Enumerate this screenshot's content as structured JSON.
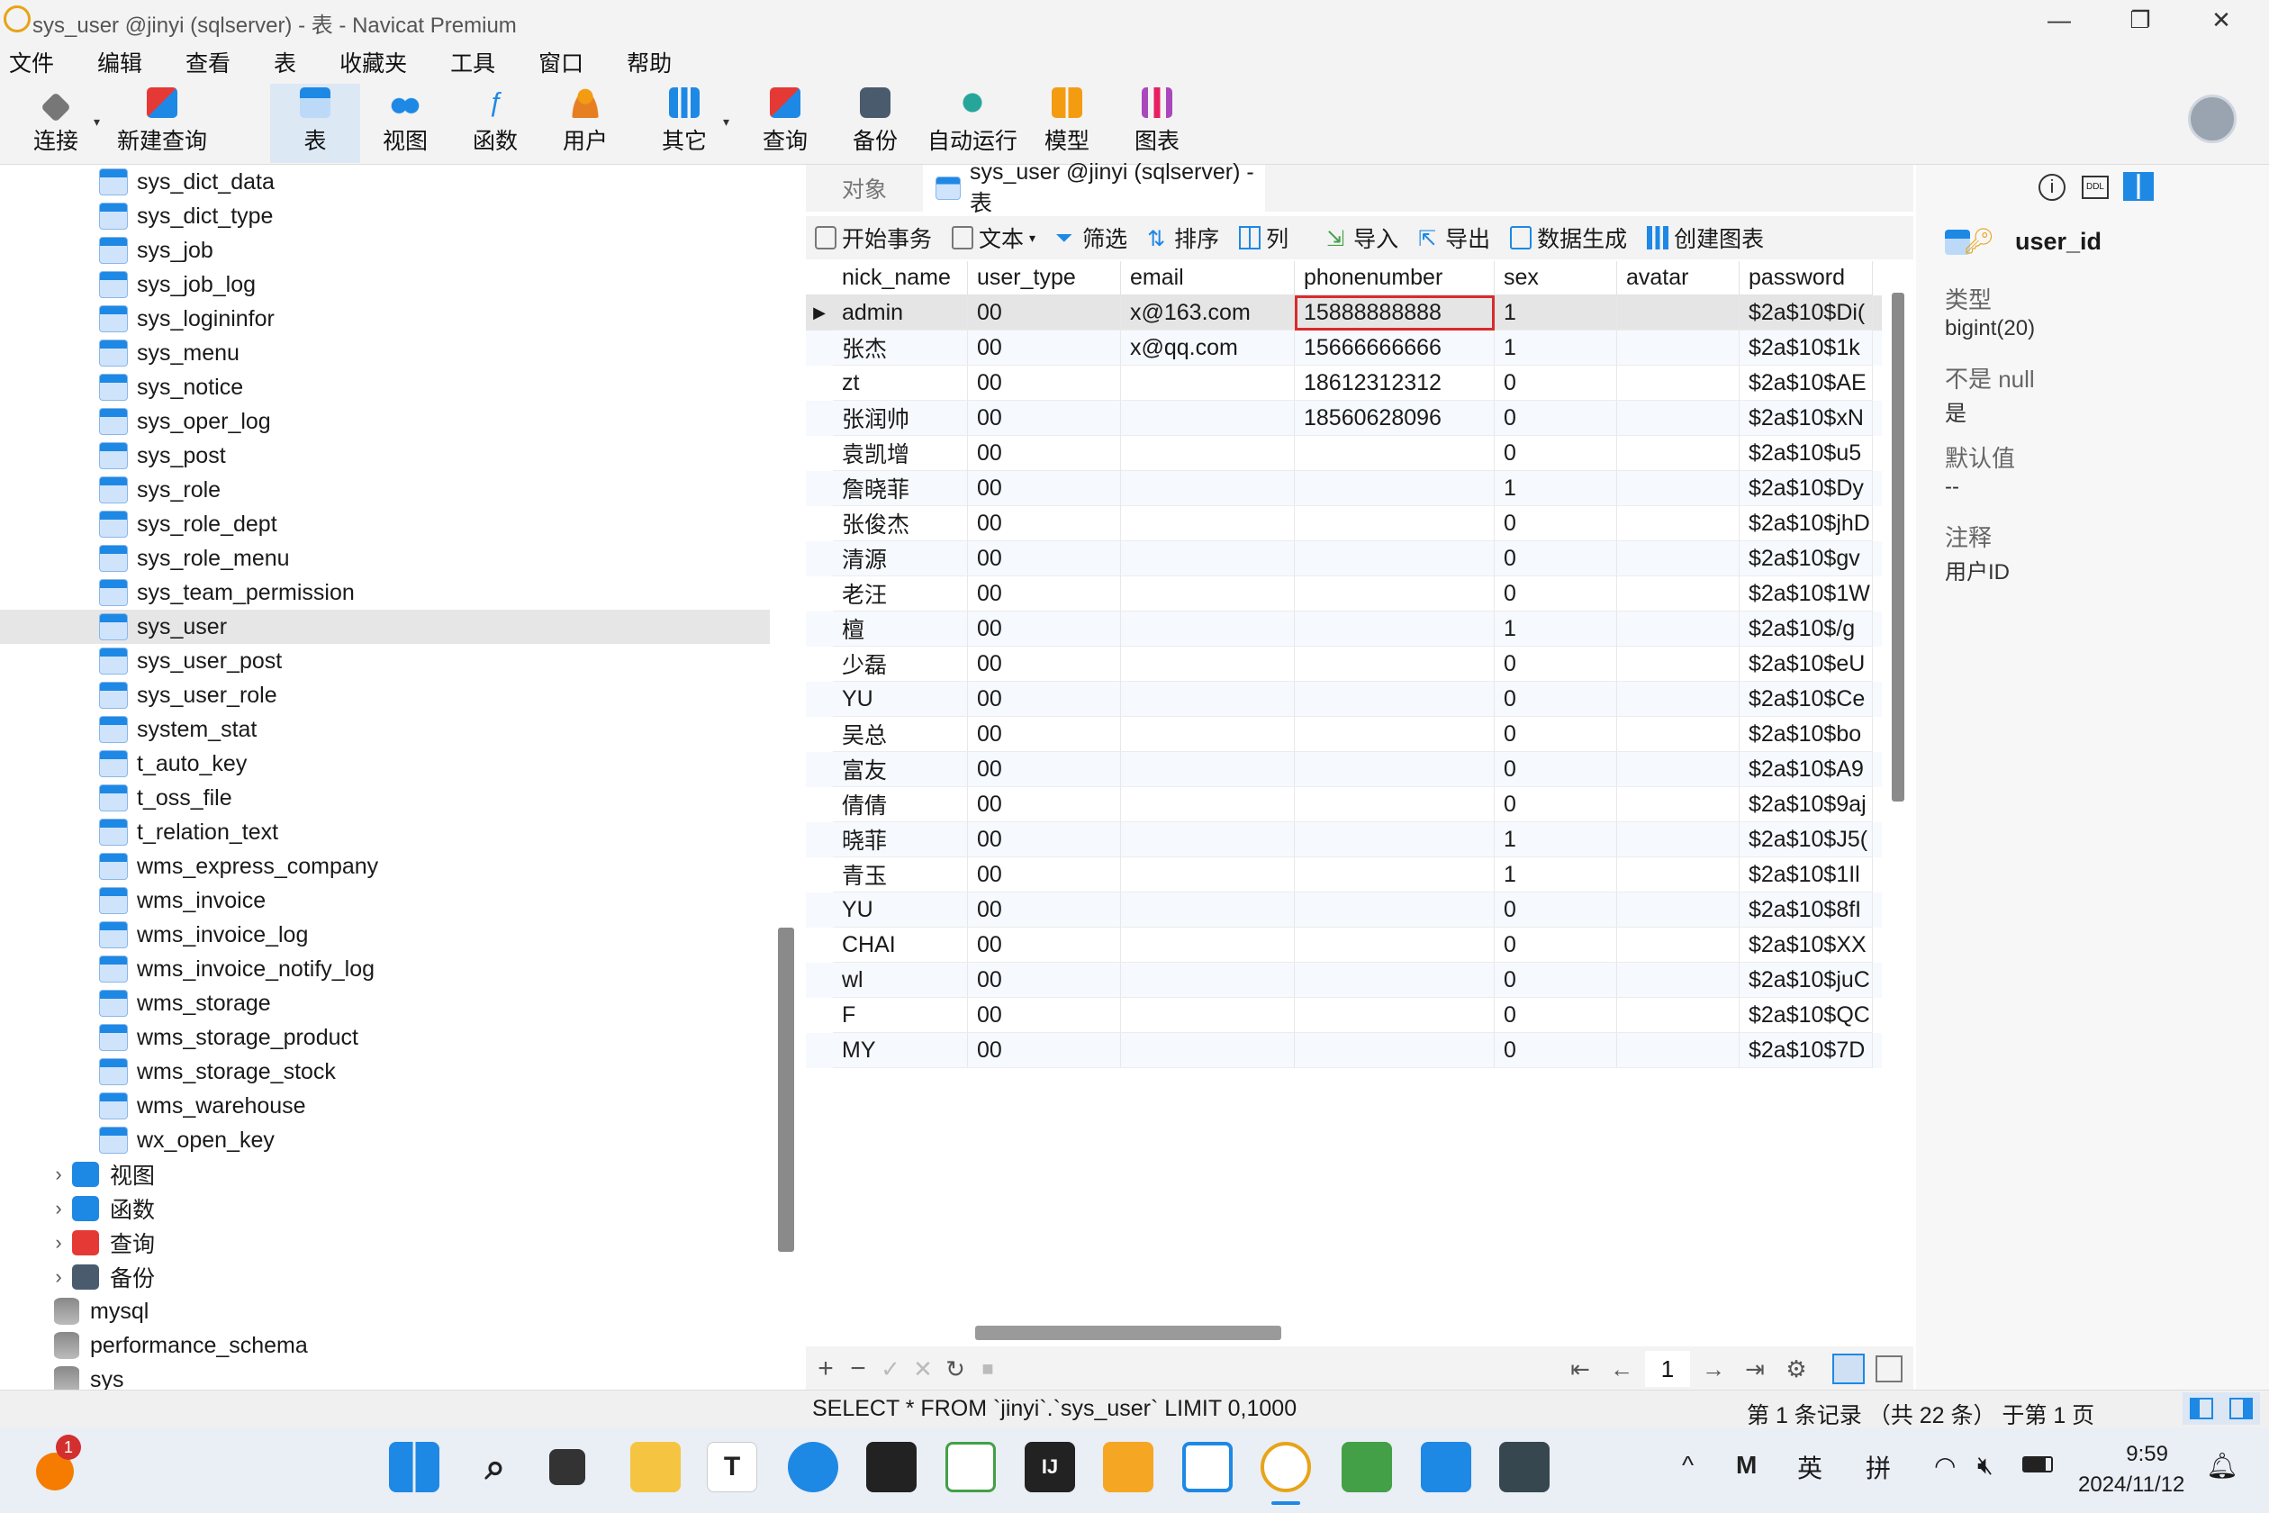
{
  "window": {
    "title": "sys_user @jinyi (sqlserver) - 表 - Navicat Premium",
    "minimize": "—",
    "maximize": "❐",
    "close": "✕"
  },
  "menu": [
    "文件",
    "编辑",
    "查看",
    "表",
    "收藏夹",
    "工具",
    "窗口",
    "帮助"
  ],
  "toolbar": {
    "connect": "连接",
    "new_query": "新建查询",
    "table": "表",
    "view": "视图",
    "function": "函数",
    "user": "用户",
    "other": "其它",
    "query": "查询",
    "backup": "备份",
    "auto_run": "自动运行",
    "model": "模型",
    "chart": "图表"
  },
  "tree": {
    "tables": [
      "sys_dict_data",
      "sys_dict_type",
      "sys_job",
      "sys_job_log",
      "sys_logininfor",
      "sys_menu",
      "sys_notice",
      "sys_oper_log",
      "sys_post",
      "sys_role",
      "sys_role_dept",
      "sys_role_menu",
      "sys_team_permission",
      "sys_user",
      "sys_user_post",
      "sys_user_role",
      "system_stat",
      "t_auto_key",
      "t_oss_file",
      "t_relation_text",
      "wms_express_company",
      "wms_invoice",
      "wms_invoice_log",
      "wms_invoice_notify_log",
      "wms_storage",
      "wms_storage_product",
      "wms_storage_stock",
      "wms_warehouse",
      "wx_open_key"
    ],
    "selected": "sys_user",
    "groups": [
      "视图",
      "函数",
      "查询",
      "备份"
    ],
    "databases": [
      "mysql",
      "performance_schema",
      "sys"
    ]
  },
  "tabs": {
    "objects": "对象",
    "current": "sys_user @jinyi (sqlserver) - 表"
  },
  "actions": {
    "begin_tx": "开始事务",
    "text": "文本",
    "filter": "筛选",
    "sort": "排序",
    "columns": "列",
    "import": "导入",
    "export": "导出",
    "data_gen": "数据生成",
    "create_chart": "创建图表"
  },
  "grid": {
    "columns": [
      "nick_name",
      "user_type",
      "email",
      "phonenumber",
      "sex",
      "avatar",
      "password"
    ],
    "rows": [
      [
        "admin",
        "00",
        "x@163.com",
        "15888888888",
        "1",
        "",
        "$2a$10$Di("
      ],
      [
        "张杰",
        "00",
        "x@qq.com",
        "15666666666",
        "1",
        "",
        "$2a$10$1k"
      ],
      [
        "zt",
        "00",
        "",
        "18612312312",
        "0",
        "",
        "$2a$10$AE"
      ],
      [
        "张润帅",
        "00",
        "",
        "18560628096",
        "0",
        "",
        "$2a$10$xN"
      ],
      [
        "袁凯增",
        "00",
        "",
        "",
        "0",
        "",
        "$2a$10$u5"
      ],
      [
        "詹晓菲",
        "00",
        "",
        "",
        "1",
        "",
        "$2a$10$Dy"
      ],
      [
        "张俊杰",
        "00",
        "",
        "",
        "0",
        "",
        "$2a$10$jhD"
      ],
      [
        "清源",
        "00",
        "",
        "",
        "0",
        "",
        "$2a$10$gv"
      ],
      [
        "老汪",
        "00",
        "",
        "",
        "0",
        "",
        "$2a$10$1W"
      ],
      [
        "檀",
        "00",
        "",
        "",
        "1",
        "",
        "$2a$10$/g"
      ],
      [
        "少磊",
        "00",
        "",
        "",
        "0",
        "",
        "$2a$10$eU"
      ],
      [
        "YU",
        "00",
        "",
        "",
        "0",
        "",
        "$2a$10$Ce"
      ],
      [
        "吴总",
        "00",
        "",
        "",
        "0",
        "",
        "$2a$10$bo"
      ],
      [
        "富友",
        "00",
        "",
        "",
        "0",
        "",
        "$2a$10$A9"
      ],
      [
        "倩倩",
        "00",
        "",
        "",
        "0",
        "",
        "$2a$10$9aj"
      ],
      [
        "晓菲",
        "00",
        "",
        "",
        "1",
        "",
        "$2a$10$J5("
      ],
      [
        "青玉",
        "00",
        "",
        "",
        "1",
        "",
        "$2a$10$1Il"
      ],
      [
        "YU",
        "00",
        "",
        "",
        "0",
        "",
        "$2a$10$8fI"
      ],
      [
        "CHAI",
        "00",
        "",
        "",
        "0",
        "",
        "$2a$10$XX"
      ],
      [
        "wl",
        "00",
        "",
        "",
        "0",
        "",
        "$2a$10$juC"
      ],
      [
        "F",
        "00",
        "",
        "",
        "0",
        "",
        "$2a$10$QC"
      ],
      [
        "MY",
        "00",
        "",
        "",
        "0",
        "",
        "$2a$10$7D"
      ]
    ],
    "current_row_marker": "▶"
  },
  "navbar": {
    "add": "+",
    "delete": "−",
    "apply": "✓",
    "cancel": "✕",
    "refresh": "↻",
    "stop": "■",
    "first": "⇤",
    "prev": "←",
    "page": "1",
    "next": "→",
    "last": "⇥",
    "settings": "⚙"
  },
  "right_panel": {
    "field_name": "user_id",
    "type_label": "类型",
    "type_value": "bigint(20)",
    "notnull_label": "不是 null",
    "notnull_value": "是",
    "default_label": "默认值",
    "default_value": "--",
    "comment_label": "注释",
    "comment_value": "用户ID",
    "ddl_badge": "DDL"
  },
  "status": {
    "sql": "SELECT * FROM `jinyi`.`sys_user` LIMIT 0,1000",
    "record_info": "第 1 条记录 （共 22 条） 于第 1 页"
  },
  "taskbar": {
    "badge": "1",
    "ime_en": "英",
    "ime_pinyin": "拼",
    "time": "9:59",
    "date": "2024/11/12"
  },
  "colors": {
    "accent": "#1e88e5",
    "highlight_border": "#d92b2b",
    "selected_row": "#e5e5e5"
  }
}
